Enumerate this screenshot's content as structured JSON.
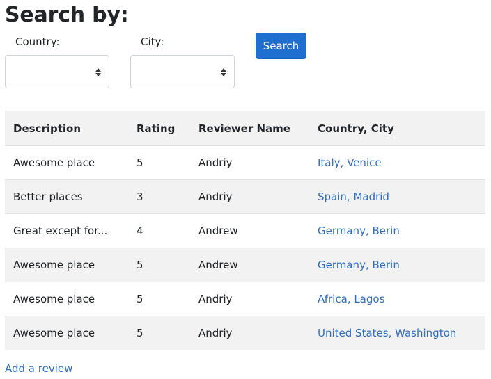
{
  "page": {
    "title": "Search by:"
  },
  "filters": {
    "country_label": "Country:",
    "country_value": "",
    "city_label": "City:",
    "city_value": "",
    "search_label": "Search"
  },
  "table": {
    "columns": [
      "Description",
      "Rating",
      "Reviewer Name",
      "Country, City"
    ],
    "rows": [
      {
        "description": "Awesome place",
        "rating": "5",
        "reviewer": "Andriy",
        "location": "Italy, Venice"
      },
      {
        "description": "Better places",
        "rating": "3",
        "reviewer": "Andriy",
        "location": "Spain, Madrid"
      },
      {
        "description": "Great except for...",
        "rating": "4",
        "reviewer": "Andrew",
        "location": "Germany, Berin"
      },
      {
        "description": "Awesome place",
        "rating": "5",
        "reviewer": "Andrew",
        "location": "Germany, Berin"
      },
      {
        "description": "Awesome place",
        "rating": "5",
        "reviewer": "Andriy",
        "location": "Africa, Lagos"
      },
      {
        "description": "Awesome place",
        "rating": "5",
        "reviewer": "Andriy",
        "location": "United States, Washington"
      }
    ]
  },
  "footer": {
    "add_review_label": "Add a review"
  },
  "colors": {
    "accent": "#1e6fcf",
    "link": "#2f6fc4",
    "stripe": "#f2f2f2",
    "border": "#dee2e6"
  },
  "icons": {
    "select_arrows": "select-arrows-icon"
  }
}
